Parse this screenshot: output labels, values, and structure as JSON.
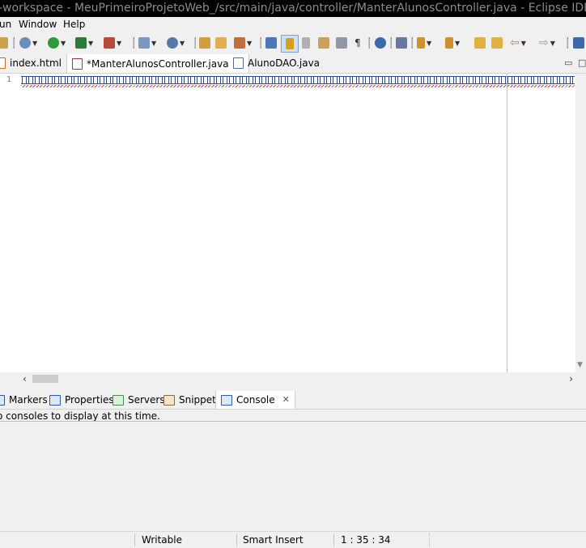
{
  "window": {
    "title": "-workspace - MeuPrimeiroProjetoWeb_/src/main/java/controller/ManterAlunosController.java - Eclipse IDE"
  },
  "menu": {
    "items": [
      "un",
      "Window",
      "Help"
    ]
  },
  "toolbar": {
    "icons": [
      "debug-icon",
      "run-icon",
      "coverage-icon",
      "external-tools-icon",
      "new-server-icon",
      "open-type-icon",
      "open-task-icon",
      "toggle-mark-occurrences-icon",
      "toggle-breadcrumb-icon",
      "show-whitespace-icon",
      "search-icon",
      "next-annotation-icon",
      "previous-annotation-icon",
      "back-icon",
      "forward-icon"
    ]
  },
  "editor_tabs": [
    {
      "label": "index.html",
      "active": false
    },
    {
      "label": "*ManterAlunosController.java",
      "active": true
    },
    {
      "label": "AlunoDAO.java",
      "active": false
    }
  ],
  "editor": {
    "line_number": "1",
    "content_description": "line of unreadable glyph boxes"
  },
  "views": {
    "tabs": [
      {
        "label": "Markers",
        "active": false
      },
      {
        "label": "Properties",
        "active": false
      },
      {
        "label": "Servers",
        "active": false
      },
      {
        "label": "Snippets",
        "active": false
      },
      {
        "label": "Console",
        "active": true
      }
    ],
    "console_message": "o consoles to display at this time."
  },
  "status": {
    "mode": "Writable",
    "insert": "Smart Insert",
    "position": "1 : 35 : 34"
  },
  "colors": {
    "titlebar_bg": "#000000",
    "chrome_bg": "#f0f0f0",
    "editor_bg": "#ffffff",
    "error_squiggle": "#e0305a"
  }
}
